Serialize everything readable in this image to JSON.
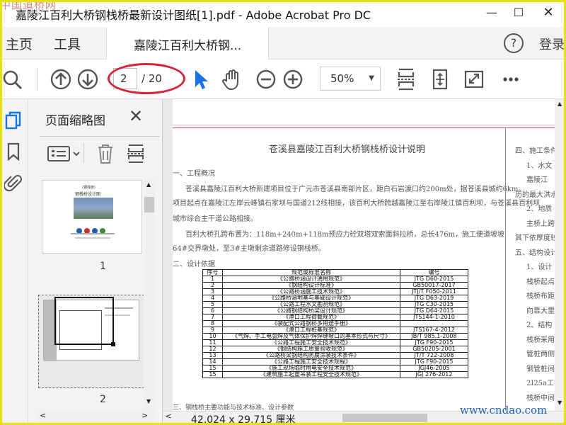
{
  "window": {
    "title": "嘉陵江百利大桥钢栈桥最新设计图纸[1].pdf - Adobe Acrobat Pro DC",
    "watermark_top": "中国道桥网"
  },
  "nav": {
    "home": "主页",
    "tools": "工具",
    "doc_tab": "嘉陵江百利大桥钢...",
    "login": "登录"
  },
  "toolbar": {
    "current_page": "2",
    "page_total": "/ 20",
    "zoom": "50%"
  },
  "panel": {
    "title": "页面缩略图",
    "thumbs": [
      {
        "label": "1"
      },
      {
        "label": "2"
      }
    ]
  },
  "status": {
    "page_size": "42.024 x 29.715 厘米"
  },
  "footer_watermark": "www.cndao.com",
  "document": {
    "heading": "苍溪县嘉陵江百利大桥钢栈桥设计说明",
    "s1": "一、工程概况",
    "p1a": "苍溪县嘉陵江百利大桥新建项目位于广元市苍溪县南部片区，距白石岩渡口约200m处，据苍溪县城约6km。",
    "p1b": "项目起点在嘉陵江左岸云峰镇石家坝与国道212线相接，该百利大桥跨越嘉陵江至右岸陵江镇百利坝，与苍溪县百利坝",
    "p1c": "城市综合主干道公路相接。",
    "p1d": "百利大桥孔跨布置为：118m+240m+118m预应力砼双塔双索面斜拉桥，总长476m，施工便道坡坡",
    "p1e": "64#交界墩处，至3#主墩剩余道路修设钢栈桥。",
    "s2": "二、设计依据",
    "s3": "三、钢栈桥主要功能与技术标准、设计参数",
    "right_col": [
      "四、施工条件",
      "1、水文",
      "嘉陵江",
      "历的最大洪水",
      "2、地质",
      "主桥上跨",
      "其下依厚度较",
      "五、结构设计",
      "1、设计",
      "栈桥起点",
      "栈桥布距8",
      "向靠大里程方",
      "2、结构",
      "栈桥采用",
      "管桩两侧采用",
      "钢管桩间横",
      "2I25a工字钢",
      "栈桥中间"
    ],
    "table_header": [
      "序号",
      "规范或标准名称",
      "编号"
    ],
    "table_rows": [
      [
        "1",
        "《公路桥涵设计通用规范》",
        "JTG D60-2015"
      ],
      [
        "2",
        "《钢结构设计标准》",
        "GB50017-2017"
      ],
      [
        "3",
        "《公路桥涵施工技术规范》",
        "JTJ/T F050-2011"
      ],
      [
        "4",
        "《公路桥涵地基与基础设计规范》",
        "JTG D63-2019"
      ],
      [
        "5",
        "《公路工程水文勘测规范》",
        "JTG C30-2015"
      ],
      [
        "6",
        "《公路钢结构桥梁设计规范》",
        "JTG D64-2015"
      ],
      [
        "7",
        "《港口工程荷载规范》",
        "JTS144-1-2010"
      ],
      [
        "8",
        "《装配式公路钢桥多用途手册》",
        ""
      ],
      [
        "9",
        "《港口工程桩基规范》",
        "JTS167-4-2012"
      ],
      [
        "10",
        "《气焊、手工电弧焊及气体保护焊焊缝坡口的基本形式与尺寸》",
        "JB/T 985.1-2008"
      ],
      [
        "11",
        "《公路工程施工安全技术规范》",
        "JTG F90-2015"
      ],
      [
        "12",
        "《钢结构施工质量验收规范》",
        "GB50205-2001"
      ],
      [
        "13",
        "《公路桥梁钢结构防腐涂装技术条件》",
        "JT/T 722-2008"
      ],
      [
        "14",
        "《公路工程施工安全技术规程》",
        "JTG F90-2015"
      ],
      [
        "15",
        "《施工现场临时用电安全技术规范》",
        "JGJ46-2005"
      ],
      [
        "15",
        "《建筑施工起重吊装工程安全技术规范》",
        "JGJ 276-2012"
      ]
    ]
  },
  "thumb1": {
    "line1": "(钢栈桥)",
    "line2": "钢栈桥设计图"
  },
  "colors": {
    "accent": "#1473e6",
    "annotation": "#d8243b",
    "frame": "#e8e200"
  }
}
